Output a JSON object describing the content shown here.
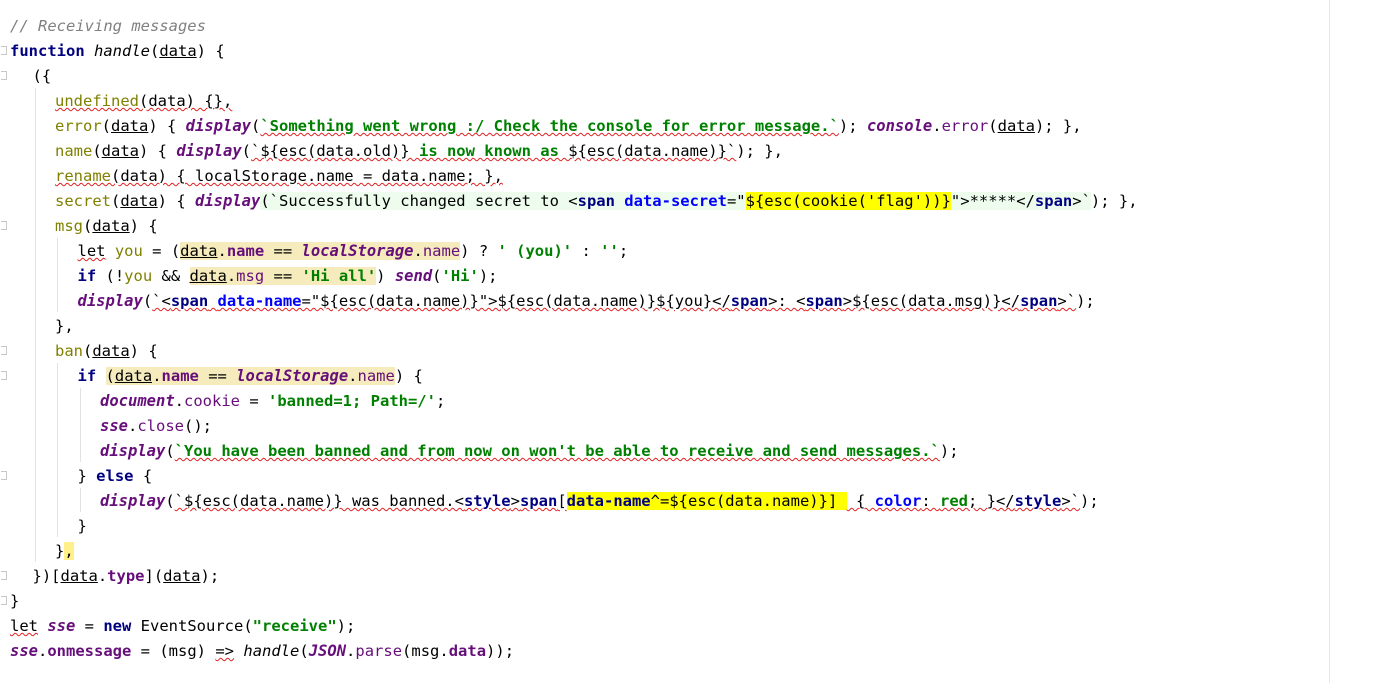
{
  "editor": {
    "language": "JavaScript",
    "lines": [
      {
        "indent": 0,
        "tokens": [
          {
            "t": "// Receiving messages",
            "c": "cm"
          }
        ]
      },
      {
        "indent": 0,
        "tokens": [
          {
            "t": "function",
            "c": "kw"
          },
          {
            "t": " ",
            "c": "pl"
          },
          {
            "t": "handle",
            "c": "fd"
          },
          {
            "t": "(",
            "c": "pl"
          },
          {
            "t": "data",
            "c": "pl und"
          },
          {
            "t": ") {",
            "c": "pl"
          }
        ]
      },
      {
        "indent": 1,
        "tokens": [
          {
            "t": "({",
            "c": "pl"
          }
        ]
      },
      {
        "indent": 2,
        "tokens": [
          {
            "t": "undefined",
            "c": "un sq"
          },
          {
            "t": "(data) {},",
            "c": "pl sq"
          }
        ]
      },
      {
        "indent": 2,
        "tokens": [
          {
            "t": "error",
            "c": "un"
          },
          {
            "t": "(",
            "c": "pl"
          },
          {
            "t": "data",
            "c": "pl und"
          },
          {
            "t": ") { ",
            "c": "pl"
          },
          {
            "t": "display",
            "c": "mc"
          },
          {
            "t": "(",
            "c": "pl"
          },
          {
            "t": "`Something went wrong :/ Check the console for error message.`",
            "c": "str sq"
          },
          {
            "t": "); ",
            "c": "pl"
          },
          {
            "t": "console",
            "c": "gv"
          },
          {
            "t": ".",
            "c": "pl"
          },
          {
            "t": "error",
            "c": "prop"
          },
          {
            "t": "(",
            "c": "pl"
          },
          {
            "t": "data",
            "c": "pl und"
          },
          {
            "t": "); },",
            "c": "pl"
          }
        ]
      },
      {
        "indent": 2,
        "tokens": [
          {
            "t": "name",
            "c": "un"
          },
          {
            "t": "(",
            "c": "pl"
          },
          {
            "t": "data",
            "c": "pl und"
          },
          {
            "t": ") { ",
            "c": "pl"
          },
          {
            "t": "display",
            "c": "mc"
          },
          {
            "t": "(",
            "c": "pl"
          },
          {
            "t": "`${esc(data.old)} ",
            "c": "pl sq"
          },
          {
            "t": "is now known as",
            "c": "str sq"
          },
          {
            "t": " ${esc(data.name)}`",
            "c": "pl sq"
          },
          {
            "t": "); },",
            "c": "pl"
          }
        ]
      },
      {
        "indent": 2,
        "tokens": [
          {
            "t": "rename",
            "c": "un sq"
          },
          {
            "t": "(data) { localStorage.name = data.name; },",
            "c": "pl sq"
          }
        ]
      },
      {
        "indent": 2,
        "tokens": [
          {
            "t": "secret",
            "c": "un"
          },
          {
            "t": "(",
            "c": "pl"
          },
          {
            "t": "data",
            "c": "pl und"
          },
          {
            "t": ") { ",
            "c": "pl"
          },
          {
            "t": "display",
            "c": "mc"
          },
          {
            "t": "(`Successfully changed secret to <",
            "c": "pl hs"
          },
          {
            "t": "span",
            "c": "tag hs"
          },
          {
            "t": " ",
            "c": "pl hs"
          },
          {
            "t": "data-secret",
            "c": "attr hs"
          },
          {
            "t": "=\"",
            "c": "pl hs"
          },
          {
            "t": "${esc(cookie('flag'))}",
            "c": "pl hy"
          },
          {
            "t": "\">*****</",
            "c": "pl hs"
          },
          {
            "t": "span",
            "c": "tag hs"
          },
          {
            "t": ">`",
            "c": "pl hs"
          },
          {
            "t": "); },",
            "c": "pl"
          }
        ]
      },
      {
        "indent": 2,
        "tokens": [
          {
            "t": "msg",
            "c": "un"
          },
          {
            "t": "(",
            "c": "pl"
          },
          {
            "t": "data",
            "c": "pl und"
          },
          {
            "t": ") {",
            "c": "pl"
          }
        ]
      },
      {
        "indent": 3,
        "tokens": [
          {
            "t": "let",
            "c": "pl sq"
          },
          {
            "t": " ",
            "c": "pl"
          },
          {
            "t": "you",
            "c": "un"
          },
          {
            "t": " = (",
            "c": "pl"
          },
          {
            "t": "data",
            "c": "pl hb und"
          },
          {
            "t": ".",
            "c": "pl hb"
          },
          {
            "t": "name",
            "c": "pd hb"
          },
          {
            "t": " == ",
            "c": "pl hb"
          },
          {
            "t": "localStorage",
            "c": "gv hb"
          },
          {
            "t": ".",
            "c": "pl hb"
          },
          {
            "t": "name",
            "c": "prop hb"
          },
          {
            "t": ") ? ",
            "c": "pl"
          },
          {
            "t": "' (you)'",
            "c": "str"
          },
          {
            "t": " : ",
            "c": "pl"
          },
          {
            "t": "''",
            "c": "str"
          },
          {
            "t": ";",
            "c": "pl"
          }
        ]
      },
      {
        "indent": 3,
        "tokens": [
          {
            "t": "if",
            "c": "kw"
          },
          {
            "t": " (!",
            "c": "pl"
          },
          {
            "t": "you",
            "c": "un"
          },
          {
            "t": " && ",
            "c": "pl"
          },
          {
            "t": "data",
            "c": "pl hb und"
          },
          {
            "t": ".",
            "c": "pl hb"
          },
          {
            "t": "msg",
            "c": "prop hb"
          },
          {
            "t": " == ",
            "c": "pl hb"
          },
          {
            "t": "'Hi all'",
            "c": "str hb"
          },
          {
            "t": ") ",
            "c": "pl"
          },
          {
            "t": "send",
            "c": "mc"
          },
          {
            "t": "(",
            "c": "pl"
          },
          {
            "t": "'Hi'",
            "c": "str"
          },
          {
            "t": ");",
            "c": "pl"
          }
        ]
      },
      {
        "indent": 3,
        "tokens": [
          {
            "t": "display",
            "c": "mc"
          },
          {
            "t": "(",
            "c": "pl"
          },
          {
            "t": "`<",
            "c": "pl sq"
          },
          {
            "t": "span",
            "c": "tag sq"
          },
          {
            "t": " ",
            "c": "pl sq"
          },
          {
            "t": "data-name",
            "c": "attr sq"
          },
          {
            "t": "=\"${esc(data.name)}\">${esc(data.name)}${you}</",
            "c": "pl sq"
          },
          {
            "t": "span",
            "c": "tag sq"
          },
          {
            "t": ">: <",
            "c": "pl sq"
          },
          {
            "t": "span",
            "c": "tag sq"
          },
          {
            "t": ">${esc(data.msg)}</",
            "c": "pl sq"
          },
          {
            "t": "span",
            "c": "tag sq"
          },
          {
            "t": ">`",
            "c": "pl sq"
          },
          {
            "t": ");",
            "c": "pl"
          }
        ]
      },
      {
        "indent": 2,
        "tokens": [
          {
            "t": "},",
            "c": "pl"
          }
        ]
      },
      {
        "indent": 2,
        "tokens": [
          {
            "t": "ban",
            "c": "un"
          },
          {
            "t": "(",
            "c": "pl"
          },
          {
            "t": "data",
            "c": "pl und"
          },
          {
            "t": ") {",
            "c": "pl"
          }
        ]
      },
      {
        "indent": 3,
        "tokens": [
          {
            "t": "if",
            "c": "kw"
          },
          {
            "t": " ",
            "c": "pl"
          },
          {
            "t": "(",
            "c": "pl hb"
          },
          {
            "t": "data",
            "c": "pl hb und"
          },
          {
            "t": ".",
            "c": "pl hb"
          },
          {
            "t": "name",
            "c": "pd hb"
          },
          {
            "t": " == ",
            "c": "pl hb"
          },
          {
            "t": "localStorage",
            "c": "gv hb"
          },
          {
            "t": ".",
            "c": "pl hb"
          },
          {
            "t": "name",
            "c": "prop hb"
          },
          {
            "t": ") {",
            "c": "pl"
          }
        ]
      },
      {
        "indent": 4,
        "tokens": [
          {
            "t": "document",
            "c": "gv"
          },
          {
            "t": ".",
            "c": "pl"
          },
          {
            "t": "cookie",
            "c": "prop"
          },
          {
            "t": " = ",
            "c": "pl"
          },
          {
            "t": "'banned=1; Path=/'",
            "c": "str"
          },
          {
            "t": ";",
            "c": "pl"
          }
        ]
      },
      {
        "indent": 4,
        "tokens": [
          {
            "t": "sse",
            "c": "gv"
          },
          {
            "t": ".",
            "c": "pl"
          },
          {
            "t": "close",
            "c": "prop"
          },
          {
            "t": "();",
            "c": "pl"
          }
        ]
      },
      {
        "indent": 4,
        "tokens": [
          {
            "t": "display",
            "c": "mc"
          },
          {
            "t": "(",
            "c": "pl"
          },
          {
            "t": "`You have been banned and from now on won't be able to receive and send messages.`",
            "c": "str sq"
          },
          {
            "t": ");",
            "c": "pl"
          }
        ]
      },
      {
        "indent": 3,
        "tokens": [
          {
            "t": "} ",
            "c": "pl"
          },
          {
            "t": "else",
            "c": "kw"
          },
          {
            "t": " {",
            "c": "pl"
          }
        ]
      },
      {
        "indent": 4,
        "tokens": [
          {
            "t": "display",
            "c": "mc"
          },
          {
            "t": "(",
            "c": "pl"
          },
          {
            "t": "`${esc(data.name)} was banned.<",
            "c": "pl sq"
          },
          {
            "t": "style",
            "c": "tag sq"
          },
          {
            "t": ">",
            "c": "pl sq"
          },
          {
            "t": "span",
            "c": "tag sq"
          },
          {
            "t": "[",
            "c": "pl sq"
          },
          {
            "t": "data-name",
            "c": "tag hy"
          },
          {
            "t": "^=${esc(data.name)}]",
            "c": "pl hy"
          },
          {
            "t": " ",
            "c": "pl hy"
          },
          {
            "t": " { ",
            "c": "pl sq"
          },
          {
            "t": "color",
            "c": "attr sq"
          },
          {
            "t": ": ",
            "c": "pl sq"
          },
          {
            "t": "red",
            "c": "str sq"
          },
          {
            "t": "; }</",
            "c": "pl sq"
          },
          {
            "t": "style",
            "c": "tag sq"
          },
          {
            "t": ">`",
            "c": "pl sq"
          },
          {
            "t": ");",
            "c": "pl"
          }
        ]
      },
      {
        "indent": 3,
        "tokens": [
          {
            "t": "}",
            "c": "pl"
          }
        ]
      },
      {
        "indent": 2,
        "tokens": [
          {
            "t": "}",
            "c": "pl"
          },
          {
            "t": ",",
            "c": "pl hl"
          }
        ]
      },
      {
        "indent": 1,
        "tokens": [
          {
            "t": "})[",
            "c": "pl"
          },
          {
            "t": "data",
            "c": "pl und"
          },
          {
            "t": ".",
            "c": "pl"
          },
          {
            "t": "type",
            "c": "pd"
          },
          {
            "t": "](",
            "c": "pl"
          },
          {
            "t": "data",
            "c": "pl und"
          },
          {
            "t": ");",
            "c": "pl"
          }
        ]
      },
      {
        "indent": 0,
        "tokens": [
          {
            "t": "}",
            "c": "pl"
          }
        ]
      },
      {
        "indent": 0,
        "tokens": [
          {
            "t": "let",
            "c": "pl sq"
          },
          {
            "t": " ",
            "c": "pl"
          },
          {
            "t": "sse",
            "c": "gv"
          },
          {
            "t": " = ",
            "c": "pl"
          },
          {
            "t": "new",
            "c": "kw"
          },
          {
            "t": " EventSource(",
            "c": "pl"
          },
          {
            "t": "\"receive\"",
            "c": "str"
          },
          {
            "t": ");",
            "c": "pl"
          }
        ]
      },
      {
        "indent": 0,
        "tokens": [
          {
            "t": "sse",
            "c": "gv"
          },
          {
            "t": ".",
            "c": "pl"
          },
          {
            "t": "onmessage",
            "c": "pd"
          },
          {
            "t": " = (msg) ",
            "c": "pl"
          },
          {
            "t": "=>",
            "c": "pl sq"
          },
          {
            "t": " ",
            "c": "pl"
          },
          {
            "t": "handle",
            "c": "fd"
          },
          {
            "t": "(",
            "c": "pl"
          },
          {
            "t": "JSON",
            "c": "gv"
          },
          {
            "t": ".",
            "c": "pl"
          },
          {
            "t": "parse",
            "c": "prop"
          },
          {
            "t": "(msg.",
            "c": "pl"
          },
          {
            "t": "data",
            "c": "pd"
          },
          {
            "t": "));",
            "c": "pl"
          }
        ]
      }
    ]
  }
}
